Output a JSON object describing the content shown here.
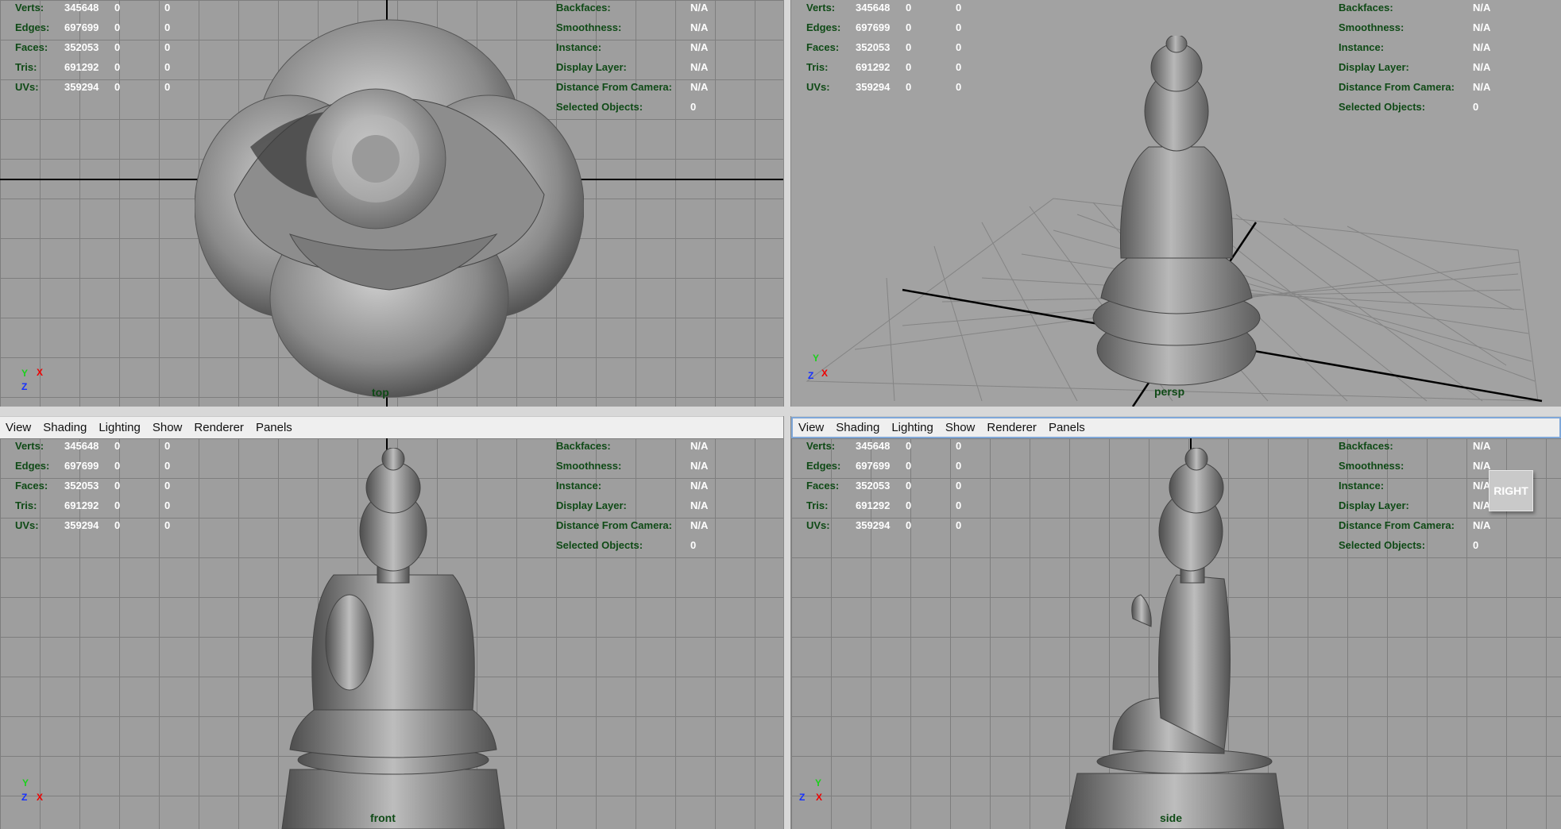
{
  "menubar": {
    "items": [
      "View",
      "Shading",
      "Lighting",
      "Show",
      "Renderer",
      "Panels"
    ]
  },
  "hud": {
    "stats": [
      {
        "label": "Verts:",
        "values": [
          "345648",
          "0",
          "0"
        ]
      },
      {
        "label": "Edges:",
        "values": [
          "697699",
          "0",
          "0"
        ]
      },
      {
        "label": "Faces:",
        "values": [
          "352053",
          "0",
          "0"
        ]
      },
      {
        "label": "Tris:",
        "values": [
          "691292",
          "0",
          "0"
        ]
      },
      {
        "label": "UVs:",
        "values": [
          "359294",
          "0",
          "0"
        ]
      }
    ],
    "info": [
      {
        "label": "Backfaces:",
        "value": "N/A"
      },
      {
        "label": "Smoothness:",
        "value": "N/A"
      },
      {
        "label": "Instance:",
        "value": "N/A"
      },
      {
        "label": "Display Layer:",
        "value": "N/A"
      },
      {
        "label": "Distance From Camera:",
        "value": "N/A"
      },
      {
        "label": "Selected Objects:",
        "value": "0"
      }
    ]
  },
  "viewports": {
    "top": {
      "camera": "top",
      "axes": [
        "Y",
        "X",
        "Z"
      ]
    },
    "persp": {
      "camera": "persp",
      "axes": [
        "Y",
        "X",
        "Z"
      ]
    },
    "front": {
      "camera": "front",
      "axes": [
        "Y",
        "X",
        "Z"
      ]
    },
    "side": {
      "camera": "side",
      "axes": [
        "Y",
        "X",
        "Z"
      ]
    }
  },
  "view_cube": {
    "label": "RIGHT"
  },
  "colors": {
    "hud_label": "#0f4a16",
    "hud_value": "#ffffff",
    "viewport_bg": "#9e9e9e",
    "grid_line": "#7e7e7e",
    "active_panel_border": "#7fa7d8"
  }
}
